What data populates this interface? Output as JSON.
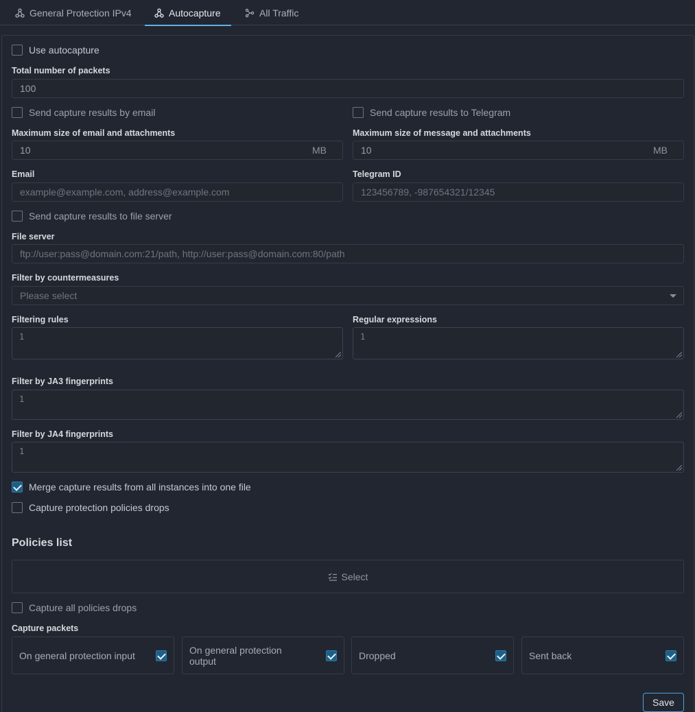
{
  "tabs": [
    {
      "label": "General Protection IPv4",
      "icon": "network-icon",
      "active": false
    },
    {
      "label": "Autocapture",
      "icon": "network-icon",
      "active": true
    },
    {
      "label": "All Traffic",
      "icon": "traffic-icon",
      "active": false
    }
  ],
  "form": {
    "use_autocapture": {
      "label": "Use autocapture",
      "checked": false
    },
    "total_packets": {
      "label": "Total number of packets",
      "value": "100"
    },
    "email_send": {
      "label": "Send capture results by email",
      "checked": false
    },
    "telegram_send": {
      "label": "Send capture results to Telegram",
      "checked": false
    },
    "email_max_size": {
      "label": "Maximum size of email and attachments",
      "value": "10",
      "unit": "MB"
    },
    "telegram_max_size": {
      "label": "Maximum size of message and attachments",
      "value": "10",
      "unit": "MB"
    },
    "email": {
      "label": "Email",
      "placeholder": "example@example.com, address@example.com"
    },
    "telegram_id": {
      "label": "Telegram ID",
      "placeholder": "123456789, -987654321/12345"
    },
    "file_server_send": {
      "label": "Send capture results to file server",
      "checked": false
    },
    "file_server": {
      "label": "File server",
      "placeholder": "ftp://user:pass@domain.com:21/path, http://user:pass@domain.com:80/path"
    },
    "countermeasures": {
      "label": "Filter by countermeasures",
      "placeholder": "Please select"
    },
    "filtering_rules": {
      "label": "Filtering rules",
      "line": "1"
    },
    "regex": {
      "label": "Regular expressions",
      "line": "1"
    },
    "ja3": {
      "label": "Filter by JA3 fingerprints",
      "line": "1"
    },
    "ja4": {
      "label": "Filter by JA4 fingerprints",
      "line": "1"
    },
    "merge": {
      "label": "Merge capture results from all instances into one file",
      "checked": true
    },
    "policy_drops": {
      "label": "Capture protection policies drops",
      "checked": false
    }
  },
  "policies": {
    "title": "Policies list",
    "select_label": "Select",
    "capture_all": {
      "label": "Capture all policies drops",
      "checked": false
    }
  },
  "capture_packets": {
    "label": "Capture packets",
    "options": [
      {
        "label": "On general protection input",
        "checked": true
      },
      {
        "label": "On general protection output",
        "checked": true
      },
      {
        "label": "Dropped",
        "checked": true
      },
      {
        "label": "Sent back",
        "checked": true
      }
    ]
  },
  "save_label": "Save",
  "colors": {
    "background": "#222630",
    "accent": "#5fb0e8",
    "checkbox_checked": "#1e5f85"
  }
}
